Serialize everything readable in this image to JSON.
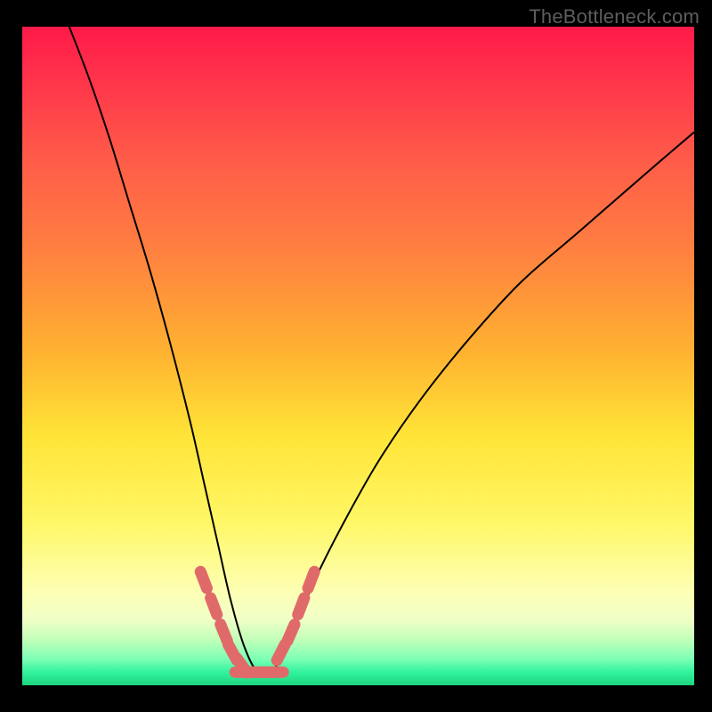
{
  "watermark": "TheBottleneck.com",
  "colors": {
    "background": "#000000",
    "curve": "#000000",
    "highlight": "#e06a6a",
    "gradient_top": "#ff1a49",
    "gradient_bottom": "#1dd47d"
  },
  "chart_data": {
    "type": "line",
    "title": "",
    "xlabel": "",
    "ylabel": "",
    "xlim": [
      0,
      100
    ],
    "ylim": [
      0,
      100
    ],
    "annotations": [],
    "description": "Bottleneck curve on a red-to-green vertical gradient. A single black curve descends steeply from the top-left, reaches a flat minimum near x≈32–38 at the very bottom (green band), then rises toward the upper right. Short pink/coral dashed segments highlight the region around the minimum on both sides.",
    "series": [
      {
        "name": "curve",
        "x": [
          7,
          10,
          13,
          16,
          19,
          22,
          25,
          27,
          29,
          31,
          33,
          35,
          37,
          39,
          41,
          44,
          48,
          53,
          59,
          66,
          74,
          83,
          92,
          100
        ],
        "y": [
          100,
          92,
          83,
          73,
          63,
          52,
          40,
          31,
          22,
          13,
          6,
          2,
          2,
          5,
          10,
          17,
          25,
          34,
          43,
          52,
          61,
          69,
          77,
          84
        ]
      }
    ],
    "highlight_segments": {
      "left": {
        "x": [
          27,
          28.5,
          30,
          31.3,
          32.7
        ],
        "y": [
          16,
          12,
          8,
          5,
          3
        ]
      },
      "floor": {
        "x": [
          33,
          34.5,
          36,
          37.5
        ],
        "y": [
          2,
          2,
          2,
          2
        ]
      },
      "right": {
        "x": [
          38.5,
          40,
          41.5,
          43
        ],
        "y": [
          5,
          8,
          12,
          16
        ]
      }
    }
  }
}
